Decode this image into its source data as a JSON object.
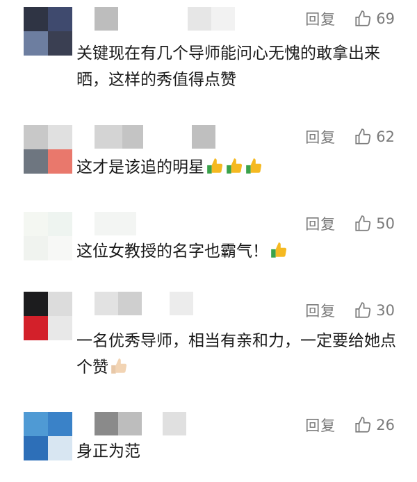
{
  "comments": [
    {
      "text": "关键现在有几个导师能问心无愧的敢拿出来晒，这样的秀值得点赞",
      "reply": "回复",
      "likes": "69",
      "emoji_count": 0,
      "emoji": "thumbs-up-icon"
    },
    {
      "text": "这才是该追的明星",
      "reply": "回复",
      "likes": "62",
      "emoji_count": 3,
      "emoji": "thumbs-up-icon"
    },
    {
      "text": "这位女教授的名字也霸气！",
      "reply": "回复",
      "likes": "50",
      "emoji_count": 1,
      "emoji": "thumbs-up-icon"
    },
    {
      "text": "一名优秀导师，相当有亲和力，一定要给她点个赞",
      "reply": "回复",
      "likes": "30",
      "emoji_count": 1,
      "emoji": "thumbs-up-light-icon"
    },
    {
      "text": "身正为范",
      "reply": "回复",
      "likes": "26",
      "emoji_count": 0,
      "emoji": ""
    }
  ],
  "colors": {
    "text": "#1a1a1a",
    "meta": "#7a7a7a",
    "emoji_yellow": "#f5b921",
    "emoji_green": "#3aa24a"
  }
}
